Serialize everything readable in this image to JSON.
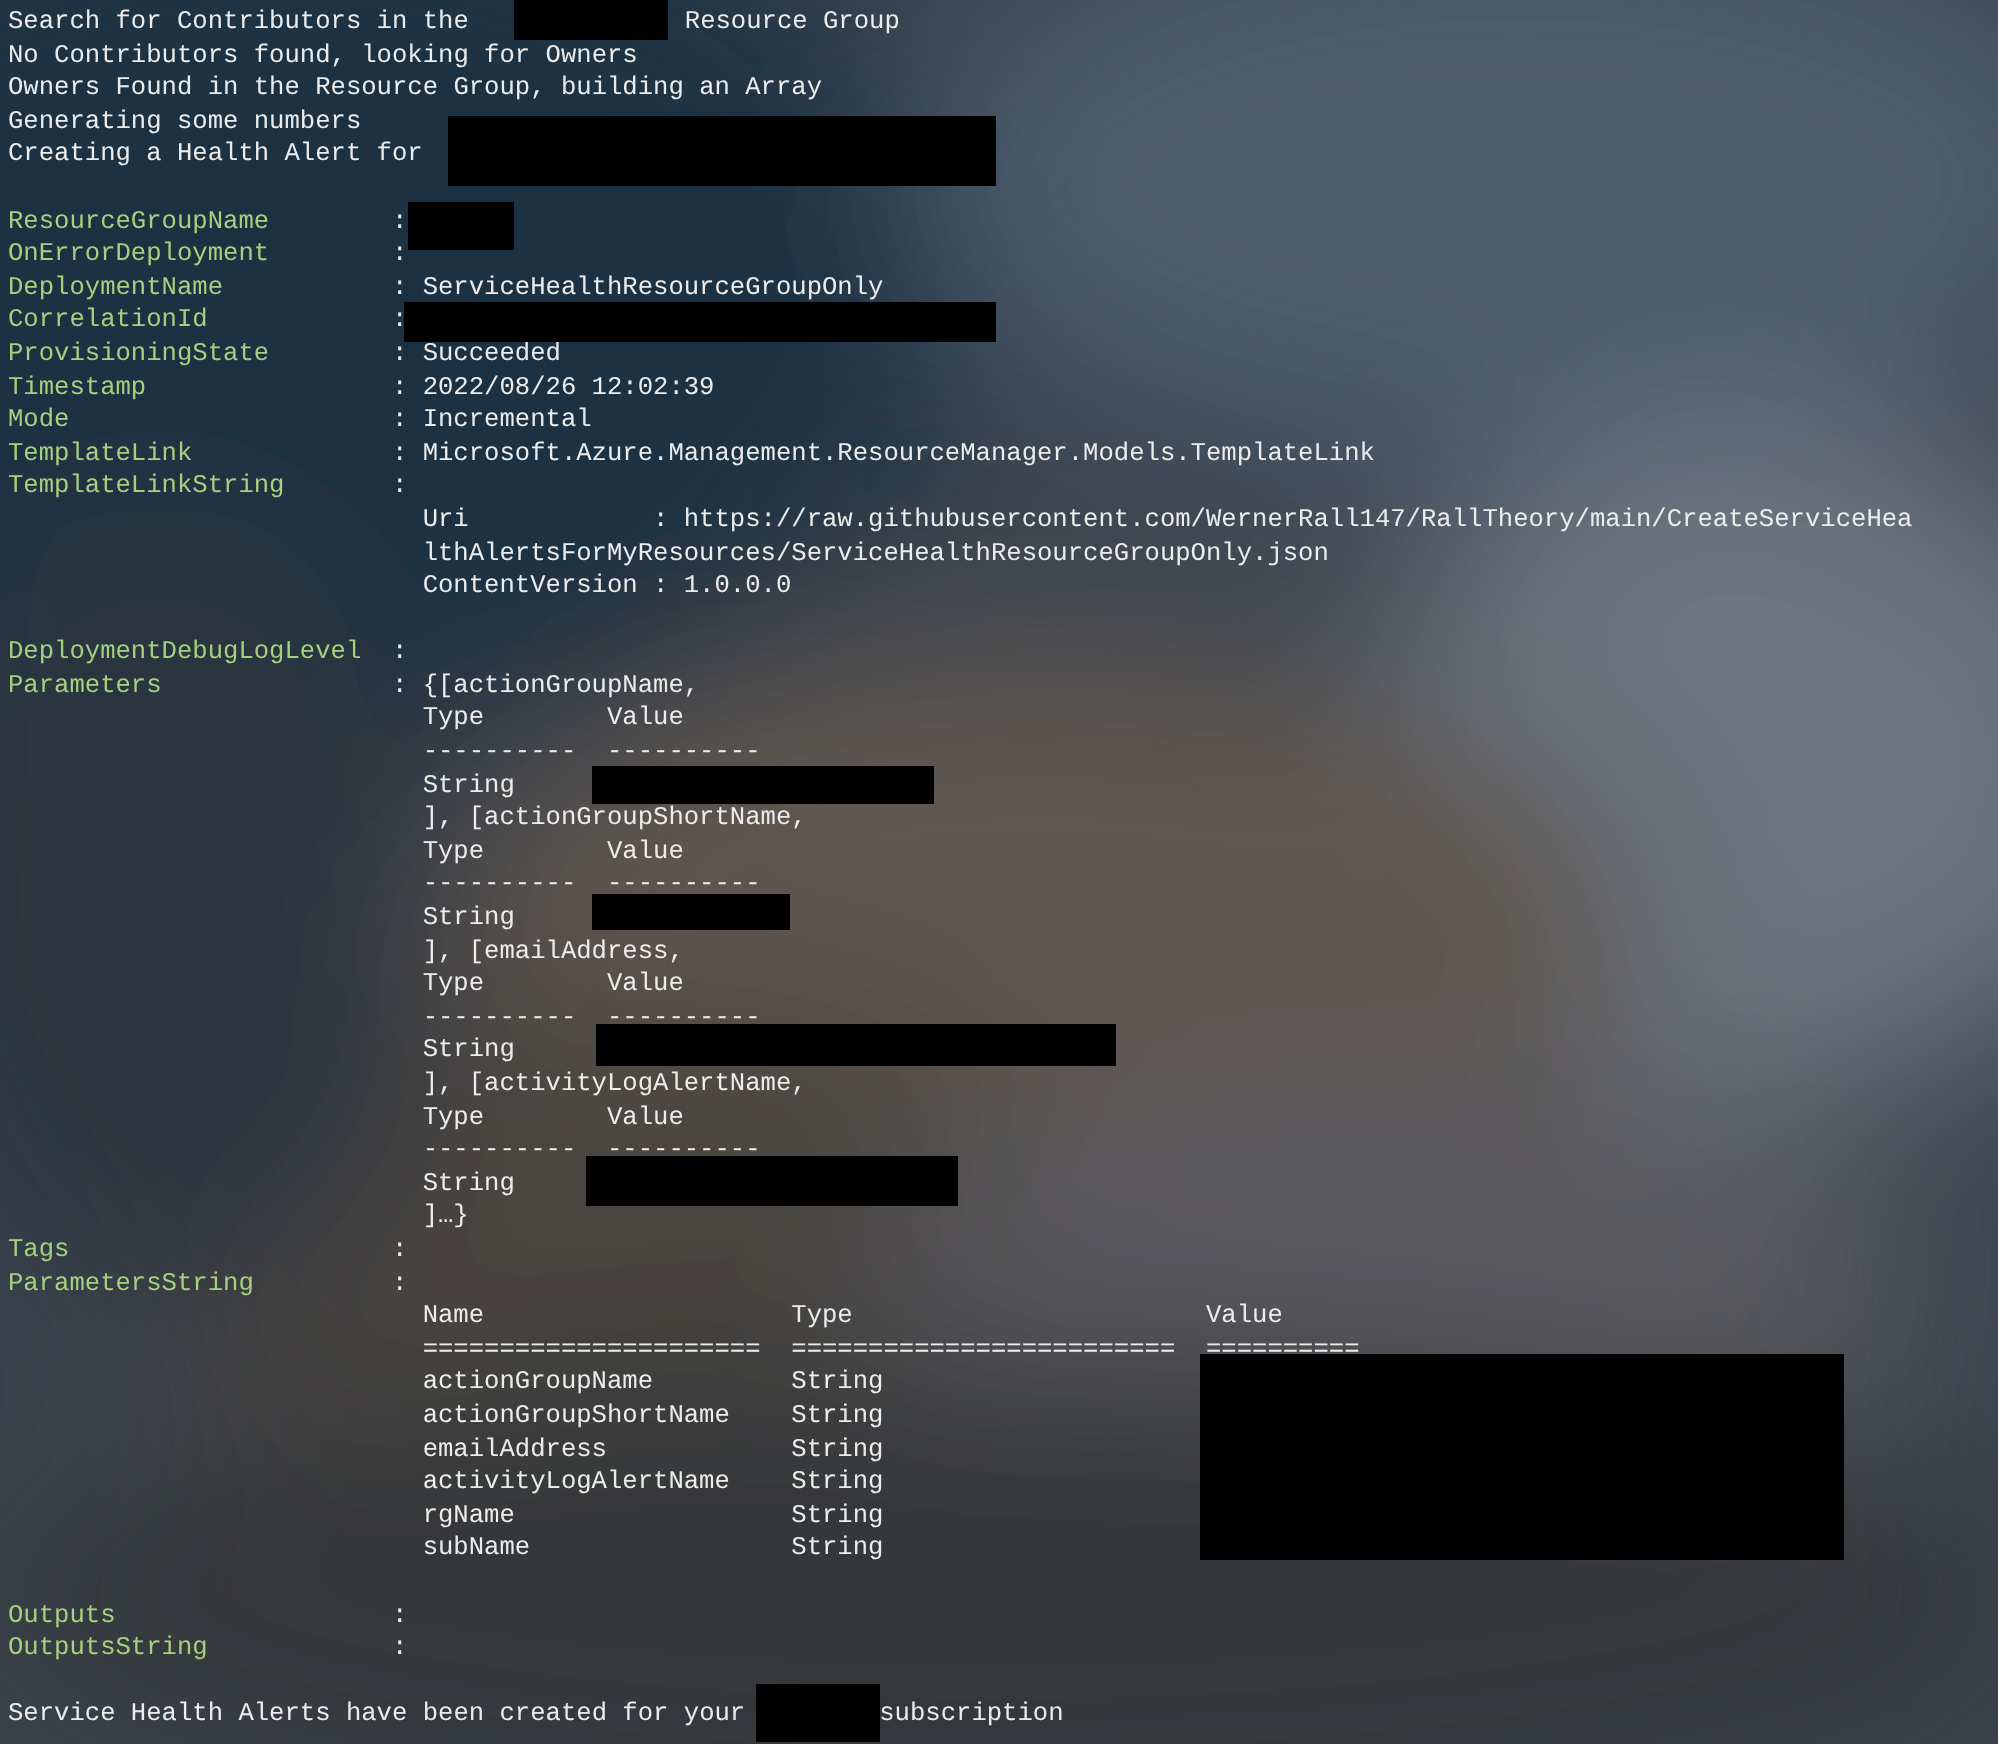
{
  "terminal": {
    "lines": [
      {
        "kind": "message",
        "segments": [
          {
            "kind": "text",
            "text": "Search for Contributors in the"
          },
          {
            "kind": "redacted"
          },
          {
            "kind": "text",
            "text": "Resource Group"
          }
        ]
      },
      {
        "kind": "message",
        "segments": [
          {
            "kind": "text",
            "text": "No Contributors found, looking for Owners"
          }
        ]
      },
      {
        "kind": "message",
        "segments": [
          {
            "kind": "text",
            "text": "Owners Found in the Resource Group, building an Array"
          }
        ]
      },
      {
        "kind": "message",
        "segments": [
          {
            "kind": "text",
            "text": "Generating some numbers"
          }
        ]
      },
      {
        "kind": "message",
        "segments": [
          {
            "kind": "text",
            "text": "Creating a Health Alert for"
          },
          {
            "kind": "redacted"
          }
        ]
      },
      {
        "kind": "blank"
      },
      {
        "kind": "property",
        "name": "ResourceGroupName",
        "separator": ":",
        "value": [
          {
            "kind": "redacted"
          }
        ]
      },
      {
        "kind": "property",
        "name": "OnErrorDeployment",
        "separator": ":"
      },
      {
        "kind": "property",
        "name": "DeploymentName",
        "separator": ":",
        "value": [
          {
            "kind": "text",
            "text": "ServiceHealthResourceGroupOnly"
          }
        ]
      },
      {
        "kind": "property",
        "name": "CorrelationId",
        "separator": ":",
        "value": [
          {
            "kind": "redacted"
          }
        ]
      },
      {
        "kind": "property",
        "name": "ProvisioningState",
        "separator": ":",
        "value": [
          {
            "kind": "text",
            "text": "Succeeded"
          }
        ]
      },
      {
        "kind": "property",
        "name": "Timestamp",
        "separator": ":",
        "value": [
          {
            "kind": "text",
            "text": "2022/08/26 12:02:39"
          }
        ]
      },
      {
        "kind": "property",
        "name": "Mode",
        "separator": ":",
        "value": [
          {
            "kind": "text",
            "text": "Incremental"
          }
        ]
      },
      {
        "kind": "property",
        "name": "TemplateLink",
        "separator": ":",
        "value": [
          {
            "kind": "text",
            "text": "Microsoft.Azure.Management.ResourceManager.Models.TemplateLink"
          }
        ]
      },
      {
        "kind": "property",
        "name": "TemplateLinkString",
        "separator": ":"
      },
      {
        "kind": "indented",
        "segments": [
          {
            "kind": "text",
            "text": "Uri            : https://raw.githubusercontent.com/WernerRall147/RallTheory/main/CreateServiceHea"
          }
        ]
      },
      {
        "kind": "indented",
        "segments": [
          {
            "kind": "text",
            "text": "lthAlertsForMyResources/ServiceHealthResourceGroupOnly.json"
          }
        ]
      },
      {
        "kind": "indented",
        "segments": [
          {
            "kind": "text",
            "text": "ContentVersion : 1.0.0.0"
          }
        ]
      },
      {
        "kind": "blank"
      },
      {
        "kind": "property",
        "name": "DeploymentDebugLogLevel",
        "separator": ":"
      },
      {
        "kind": "property",
        "name": "Parameters",
        "separator": ":",
        "value": [
          {
            "kind": "text",
            "text": "{[actionGroupName,"
          }
        ]
      },
      {
        "kind": "indented",
        "segments": [
          {
            "kind": "text",
            "text": "Type        Value"
          }
        ]
      },
      {
        "kind": "indented",
        "segments": [
          {
            "kind": "text",
            "text": "----------  ----------"
          }
        ]
      },
      {
        "kind": "indented",
        "segments": [
          {
            "kind": "text",
            "text": "String"
          },
          {
            "kind": "redacted"
          }
        ]
      },
      {
        "kind": "indented",
        "segments": [
          {
            "kind": "text",
            "text": "], [actionGroupShortName,"
          }
        ]
      },
      {
        "kind": "indented",
        "segments": [
          {
            "kind": "text",
            "text": "Type        Value"
          }
        ]
      },
      {
        "kind": "indented",
        "segments": [
          {
            "kind": "text",
            "text": "----------  ----------"
          }
        ]
      },
      {
        "kind": "indented",
        "segments": [
          {
            "kind": "text",
            "text": "String"
          },
          {
            "kind": "redacted"
          }
        ]
      },
      {
        "kind": "indented",
        "segments": [
          {
            "kind": "text",
            "text": "], [emailAddress,"
          }
        ]
      },
      {
        "kind": "indented",
        "segments": [
          {
            "kind": "text",
            "text": "Type        Value"
          }
        ]
      },
      {
        "kind": "indented",
        "segments": [
          {
            "kind": "text",
            "text": "----------  ----------"
          }
        ]
      },
      {
        "kind": "indented",
        "segments": [
          {
            "kind": "text",
            "text": "String"
          },
          {
            "kind": "redacted"
          }
        ]
      },
      {
        "kind": "indented",
        "segments": [
          {
            "kind": "text",
            "text": "], [activityLogAlertName,"
          }
        ]
      },
      {
        "kind": "indented",
        "segments": [
          {
            "kind": "text",
            "text": "Type        Value"
          }
        ]
      },
      {
        "kind": "indented",
        "segments": [
          {
            "kind": "text",
            "text": "----------  ----------"
          }
        ]
      },
      {
        "kind": "indented",
        "segments": [
          {
            "kind": "text",
            "text": "String"
          },
          {
            "kind": "redacted"
          }
        ]
      },
      {
        "kind": "indented",
        "segments": [
          {
            "kind": "text",
            "text": "]…}"
          }
        ]
      },
      {
        "kind": "property",
        "name": "Tags",
        "separator": ":"
      },
      {
        "kind": "property",
        "name": "ParametersString",
        "separator": ":"
      },
      {
        "kind": "indented",
        "segments": [
          {
            "kind": "text",
            "text": "Name                    Type                       Value"
          }
        ]
      },
      {
        "kind": "indented",
        "segments": [
          {
            "kind": "text",
            "text": "======================  =========================  =========="
          }
        ]
      },
      {
        "kind": "indented",
        "segments": [
          {
            "kind": "text",
            "text": "actionGroupName         String"
          },
          {
            "kind": "redacted"
          }
        ]
      },
      {
        "kind": "indented",
        "segments": [
          {
            "kind": "text",
            "text": "actionGroupShortName    String"
          }
        ]
      },
      {
        "kind": "indented",
        "segments": [
          {
            "kind": "text",
            "text": "emailAddress            String"
          }
        ]
      },
      {
        "kind": "indented",
        "segments": [
          {
            "kind": "text",
            "text": "activityLogAlertName    String"
          }
        ]
      },
      {
        "kind": "indented",
        "segments": [
          {
            "kind": "text",
            "text": "rgName                  String"
          }
        ]
      },
      {
        "kind": "indented",
        "segments": [
          {
            "kind": "text",
            "text": "subName                 String"
          }
        ]
      },
      {
        "kind": "blank"
      },
      {
        "kind": "property",
        "name": "Outputs",
        "separator": ":"
      },
      {
        "kind": "property",
        "name": "OutputsString",
        "separator": ":"
      },
      {
        "kind": "blank"
      },
      {
        "kind": "message",
        "segments": [
          {
            "kind": "text",
            "text": "Service Health Alerts have been created for your"
          },
          {
            "kind": "redacted"
          },
          {
            "kind": "text",
            "text": "subscription"
          }
        ]
      }
    ]
  }
}
